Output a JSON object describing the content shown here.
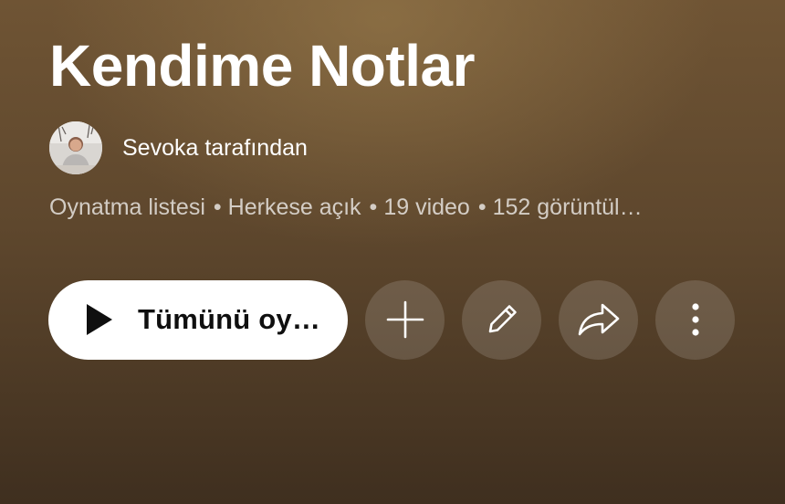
{
  "playlist": {
    "title": "Kendime Notlar",
    "owner_text": "Sevoka tarafından",
    "meta": {
      "type": "Oynatma listesi",
      "visibility": "Herkese açık",
      "video_count": "19 video",
      "views": "152 görüntül…"
    }
  },
  "actions": {
    "play_all_label": "Tümünü oy…",
    "icons": {
      "play": "play-icon",
      "add": "plus-icon",
      "edit": "pencil-icon",
      "share": "share-icon",
      "more": "more-vertical-icon"
    }
  },
  "colors": {
    "background_top": "#6f5434",
    "background_bottom": "#3f2f1f",
    "primary_button": "#ffffff",
    "primary_button_text": "#0f0f0f",
    "secondary_button": "rgba(255,255,255,0.14)",
    "meta_text": "rgba(255,255,255,0.72)"
  }
}
